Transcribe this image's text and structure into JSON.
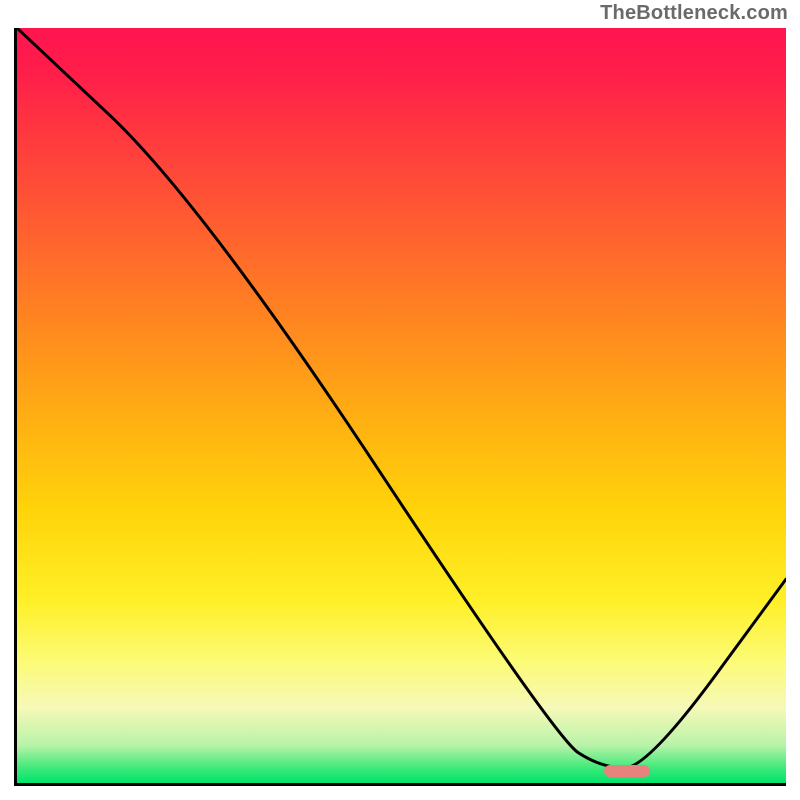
{
  "attribution": "TheBottleneck.com",
  "colors": {
    "gradient_top": "#ff1450",
    "gradient_bottom": "#00e36a",
    "curve": "#000000",
    "marker": "#e8827e",
    "axis": "#000000"
  },
  "chart_data": {
    "type": "line",
    "title": "",
    "xlabel": "",
    "ylabel": "",
    "xlim": [
      0,
      100
    ],
    "ylim": [
      0,
      100
    ],
    "grid": false,
    "legend": false,
    "series": [
      {
        "name": "curve",
        "x": [
          0,
          24,
          70,
          76,
          82,
          100
        ],
        "y": [
          100,
          77,
          6,
          2,
          2,
          27
        ]
      }
    ],
    "marker": {
      "x_start": 76,
      "x_end": 82,
      "y": 2
    },
    "note": "x and y are in percent of plot area; y increases upward"
  }
}
